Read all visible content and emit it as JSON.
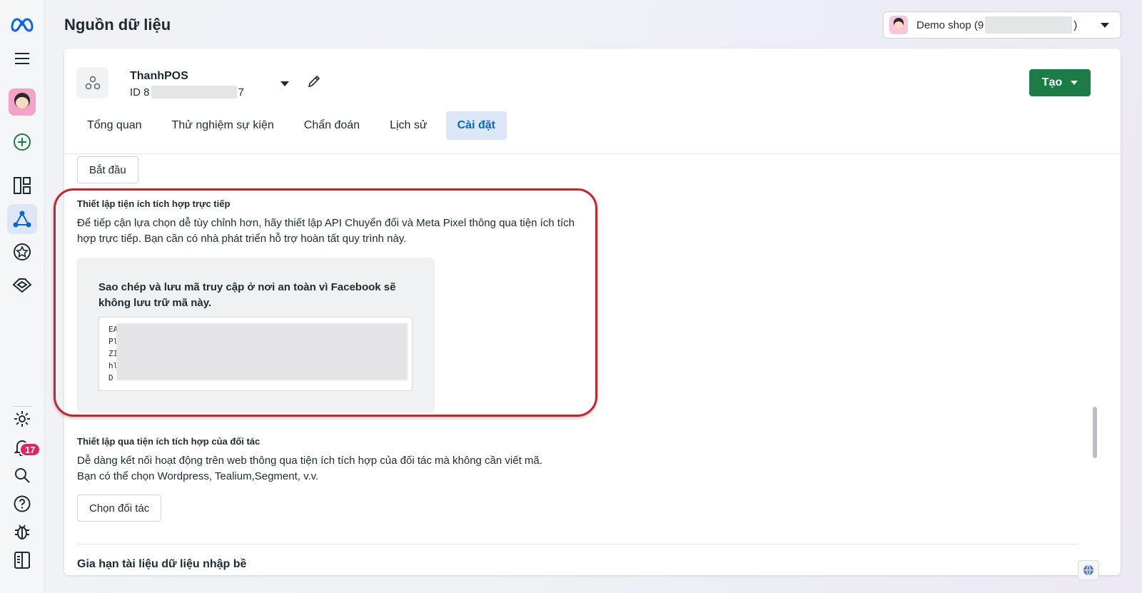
{
  "header": {
    "title": "Nguồn dữ liệu",
    "account_name": "Demo shop (9",
    "account_suffix": ")"
  },
  "rail": {
    "notification_count": "17"
  },
  "datasource": {
    "name": "ThanhPOS",
    "id_prefix": "ID 8",
    "id_suffix": "7",
    "create_label": "Tạo"
  },
  "tabs": [
    {
      "label": "Tổng quan"
    },
    {
      "label": "Thử nghiệm sự kiện"
    },
    {
      "label": "Chẩn đoán"
    },
    {
      "label": "Lịch sử"
    },
    {
      "label": "Cài đặt"
    }
  ],
  "content": {
    "start_button": "Bắt đầu",
    "direct": {
      "title": "Thiết lập tiện ích tích hợp trực tiếp",
      "description": "Để tiếp cận lựa chọn dễ tùy chỉnh hơn, hãy thiết lập API Chuyển đổi và Meta Pixel thông qua tiện ích tích hợp trực tiếp. Bạn cần có nhà phát triển hỗ trợ hoàn tất quy trình này.",
      "token_notice": "Sao chép và lưu mã truy cập ở nơi an toàn vì Facebook sẽ không lưu trữ mã này.",
      "token_lines": [
        "EA",
        "Pl",
        "ZI",
        "hl",
        "D"
      ]
    },
    "partner": {
      "title": "Thiết lập qua tiện ích tích hợp của đối tác",
      "description_line1": "Dễ dàng kết nối hoạt động trên web thông qua tiện ích tích hợp của đối tác mà không cần viết mã.",
      "description_line2": "Bạn có thể chọn Wordpress, Tealium,Segment, v.v.",
      "button": "Chọn đối tác"
    },
    "next_section_heading": "Gia hạn tài liệu dữ liệu nhập bề"
  },
  "colors": {
    "accent": "#0a66c2",
    "create_button": "#1b7d45",
    "highlight": "#c4262e",
    "badge": "#e0245e"
  }
}
